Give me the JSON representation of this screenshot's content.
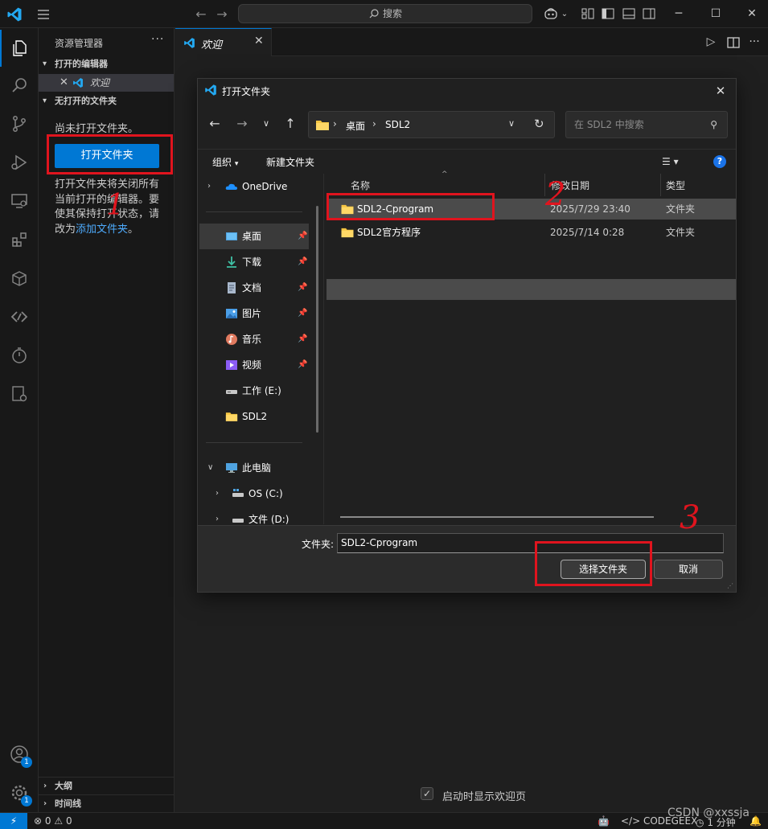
{
  "titlebar": {
    "search_placeholder": "搜索"
  },
  "sidebar": {
    "title": "资源管理器",
    "open_editors_header": "打开的编辑器",
    "open_editor_item": "欢迎",
    "no_folder_header": "无打开的文件夹",
    "no_folder_message": "尚未打开文件夹。",
    "open_folder_button": "打开文件夹",
    "description_prefix": "打开文件夹将关闭所有当前打开的编辑器。要使其保持打开状态，请改为",
    "description_link": "添加文件夹",
    "description_suffix": "。",
    "outline_header": "大纲",
    "timeline_header": "时间线"
  },
  "activity": {
    "badge_accounts": "1",
    "badge_settings": "1"
  },
  "tabs": [
    {
      "label": "欢迎"
    }
  ],
  "editor": {
    "show_welcome_label": "启动时显示欢迎页",
    "show_welcome_checked": true
  },
  "dialog": {
    "title": "打开文件夹",
    "path": [
      "桌面",
      "SDL2"
    ],
    "search_placeholder": "在 SDL2 中搜索",
    "organize_label": "组织",
    "new_folder_label": "新建文件夹",
    "help_label": "?",
    "nav": {
      "onedrive": "OneDrive",
      "quick": [
        {
          "label": "桌面",
          "icon": "desktop-icon",
          "pinned": true,
          "selected": true
        },
        {
          "label": "下载",
          "icon": "download-icon",
          "pinned": true
        },
        {
          "label": "文档",
          "icon": "document-icon",
          "pinned": true
        },
        {
          "label": "图片",
          "icon": "picture-icon",
          "pinned": true
        },
        {
          "label": "音乐",
          "icon": "music-icon",
          "pinned": true
        },
        {
          "label": "视频",
          "icon": "video-icon",
          "pinned": true
        },
        {
          "label": "工作 (E:)",
          "icon": "drive-icon"
        },
        {
          "label": "SDL2",
          "icon": "folder-icon"
        }
      ],
      "this_pc": "此电脑",
      "drives": [
        {
          "label": "OS (C:)"
        },
        {
          "label": "文件 (D:)"
        }
      ]
    },
    "columns": {
      "name": "名称",
      "modified": "修改日期",
      "type": "类型"
    },
    "files": [
      {
        "name": "SDL2-Cprogram",
        "modified": "2025/7/29 23:40",
        "type": "文件夹",
        "selected": true
      },
      {
        "name": "SDL2官方程序",
        "modified": "2025/7/14 0:28",
        "type": "文件夹",
        "selected": false
      }
    ],
    "folder_label": "文件夹:",
    "folder_value": "SDL2-Cprogram",
    "select_button": "选择文件夹",
    "cancel_button": "取消"
  },
  "statusbar": {
    "errors": "0",
    "warnings": "0",
    "codegeex": "CODEGEEX",
    "time": "1 分钟"
  },
  "annotations": [
    "1",
    "2",
    "3"
  ],
  "watermark": "CSDN @xxssja",
  "colors": {
    "accent": "#0078d4",
    "annotation_red": "#e0141e",
    "background": "#1f1f1f",
    "sidebar": "#181818"
  }
}
